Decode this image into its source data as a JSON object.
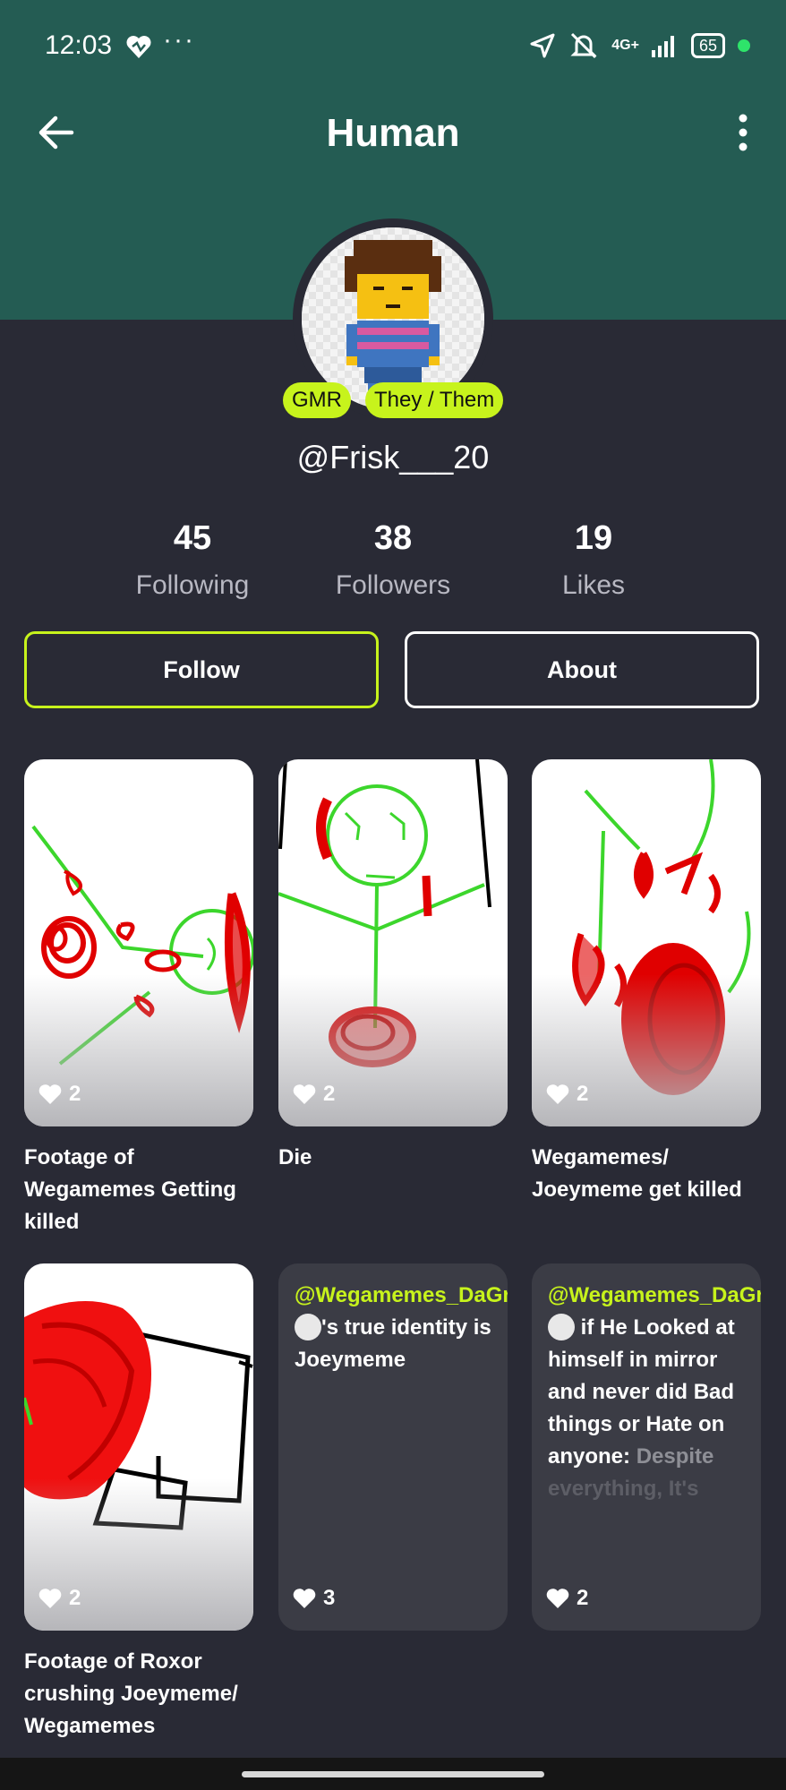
{
  "status_bar": {
    "time": "12:03",
    "more": "···",
    "network": "4G+",
    "battery": "65"
  },
  "appbar": {
    "title": "Human"
  },
  "profile": {
    "badges": [
      "GMR",
      "They / Them"
    ],
    "handle": "@Frisk___20",
    "stats": [
      {
        "value": "45",
        "label": "Following"
      },
      {
        "value": "38",
        "label": "Followers"
      },
      {
        "value": "19",
        "label": "Likes"
      }
    ]
  },
  "buttons": {
    "follow": "Follow",
    "about": "About"
  },
  "posts": [
    {
      "likes": "2",
      "caption": "Footage of Wegamemes Getting killed"
    },
    {
      "likes": "2",
      "caption": "Die"
    },
    {
      "likes": "2",
      "caption": "Wegamemes/ Joeymeme get killed"
    },
    {
      "likes": "2",
      "caption": "Footage of Roxor crushing Joeymeme/ Wegamemes"
    },
    {
      "likes": "3",
      "mention": "@Wegamemes_DaGreenguy",
      "text": "'s true identity is Joeymeme"
    },
    {
      "likes": "2",
      "mention": "@Wegamemes_DaGreenguy",
      "text": " if He Looked at himself in mirror and never did Bad things or Hate on anyone:",
      "text_fade": "Despite",
      "text_fade2": "everything, It's"
    }
  ],
  "colors": {
    "header": "#245c53",
    "background": "#292a35",
    "accent": "#c7f31c",
    "card": "#3b3c45"
  }
}
